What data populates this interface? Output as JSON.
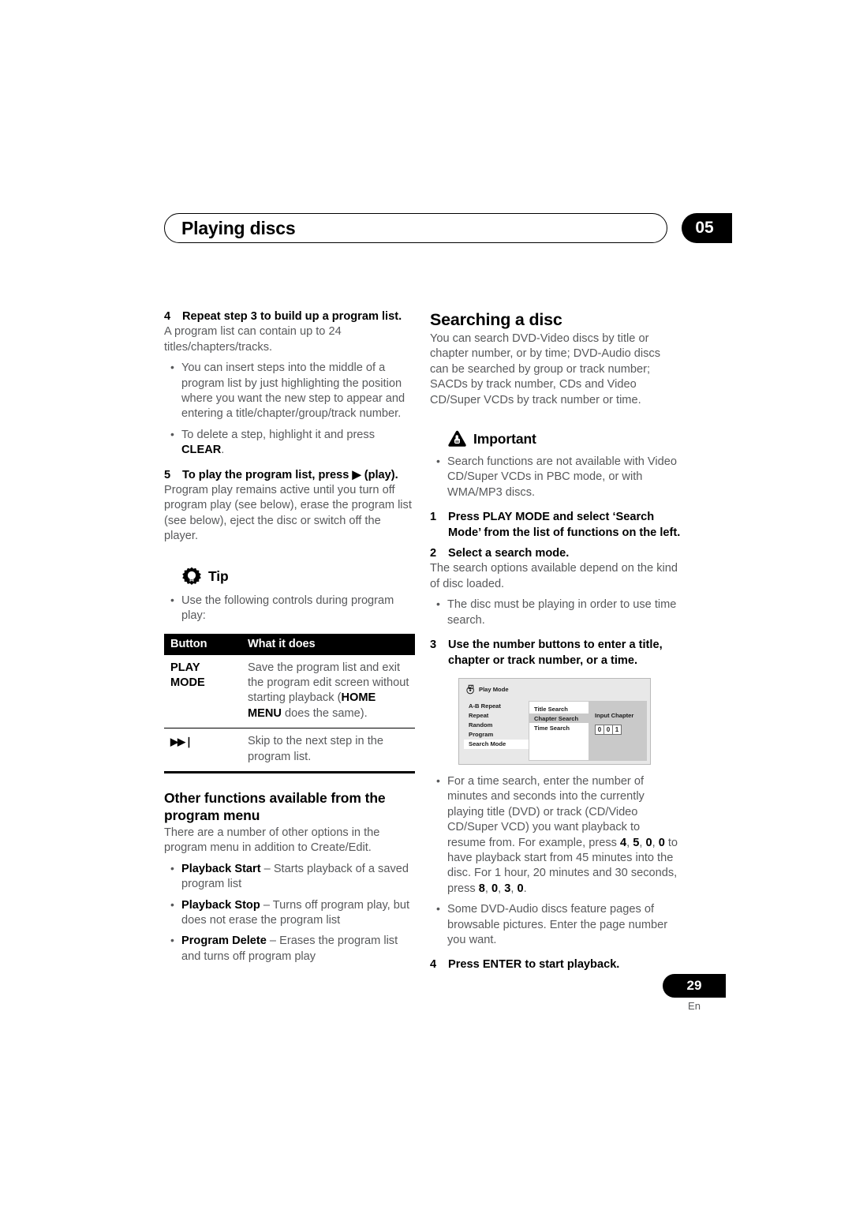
{
  "header": {
    "title": "Playing discs",
    "chapter": "05"
  },
  "left": {
    "step4": {
      "num": "4",
      "text": "Repeat step 3 to build up a program list."
    },
    "step4_body": "A program list can contain up to 24 titles/chapters/tracks.",
    "step4_bullets": [
      "You can insert steps into the middle of a program list by just highlighting the position where you want the new step to appear and entering a title/chapter/group/track number.",
      "To delete a step, highlight it and press CLEAR."
    ],
    "step5": {
      "num": "5",
      "text": "To play the program list, press ▶ (play)."
    },
    "step5_body": "Program play remains active until you turn off program play (see below), erase the program list (see below), eject the disc or switch off the player.",
    "tip": {
      "label": "Tip",
      "icon": "tip-bulb-icon",
      "bullet": "Use the following controls during program play:"
    },
    "table": {
      "headers": [
        "Button",
        "What it does"
      ],
      "rows": [
        {
          "button": "PLAY MODE",
          "button_icon": "",
          "desc": "Save the program list and exit the program edit screen without starting playback (HOME MENU does the same)."
        },
        {
          "button": "",
          "button_icon": "▶▶❘",
          "desc": "Skip to the next step in the program list."
        }
      ]
    },
    "other_heading": "Other functions available from the program menu",
    "other_body": "There are a number of other options in the program menu in addition to Create/Edit.",
    "other_bullets": [
      {
        "term": "Playback Start",
        "dash": " – ",
        "desc": "Starts playback of a saved program list"
      },
      {
        "term": "Playback Stop",
        "dash": " – ",
        "desc": "Turns off program play, but does not erase the program list"
      },
      {
        "term": "Program Delete",
        "dash": " – ",
        "desc": "Erases the program list and turns off program play"
      }
    ]
  },
  "right": {
    "heading": "Searching a disc",
    "intro": "You can search DVD-Video discs by title or chapter number, or by time; DVD-Audio discs can be searched by group or track number; SACDs by track number, CDs and Video CD/Super VCDs by track number or time.",
    "important": {
      "label": "Important",
      "icon": "important-triangle-icon",
      "bullet": "Search functions are not available with Video CD/Super VCDs in PBC mode, or with WMA/MP3 discs."
    },
    "step1": {
      "num": "1",
      "text": "Press PLAY MODE and select ‘Search Mode’ from the list of functions on the left."
    },
    "step2": {
      "num": "2",
      "text": "Select a search mode."
    },
    "step2_body": "The search options available depend on the kind of disc loaded.",
    "step2_bullet": "The disc must be playing in order to use time search.",
    "step3": {
      "num": "3",
      "text": "Use the number buttons to enter a title, chapter or track number, or a time."
    },
    "osd": {
      "title": "Play Mode",
      "title_icon": "disc-tag-icon",
      "menu": [
        "A-B Repeat",
        "Repeat",
        "Random",
        "Program",
        "Search Mode"
      ],
      "menu_selected": "Search Mode",
      "submenu": [
        "Title Search",
        "Chapter Search",
        "Time Search"
      ],
      "submenu_selected": "Chapter Search",
      "panel_label": "Input Chapter",
      "panel_digits": [
        "0",
        "0",
        "1"
      ]
    },
    "bullet_time": "For a time search, enter the number of minutes and seconds into the currently playing title (DVD) or track (CD/Video CD/Super VCD) you want playback to resume from. For example, press 4, 5, 0, 0 to have playback start from 45 minutes into the disc. For 1 hour, 20 minutes and 30 seconds, press 8, 0, 3, 0.",
    "bullet_pages": "Some DVD-Audio discs feature pages of browsable pictures. Enter the page number you want.",
    "step4": {
      "num": "4",
      "text": "Press ENTER to start playback."
    }
  },
  "footer": {
    "page": "29",
    "lang": "En"
  }
}
